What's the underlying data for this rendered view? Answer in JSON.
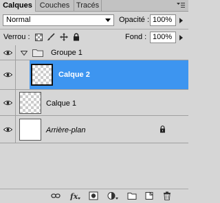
{
  "tabs": [
    {
      "label": "Calques",
      "active": true
    },
    {
      "label": "Couches",
      "active": false
    },
    {
      "label": "Tracés",
      "active": false
    }
  ],
  "blend_mode": "Normal",
  "opacity": {
    "label": "Opacité :",
    "value": "100%"
  },
  "lock": {
    "label": "Verrou :"
  },
  "fill": {
    "label": "Fond :",
    "value": "100%"
  },
  "layers": [
    {
      "name": "Groupe 1",
      "type": "group",
      "selected": false
    },
    {
      "name": "Calque 2",
      "type": "layer",
      "selected": true
    },
    {
      "name": "Calque 1",
      "type": "layer",
      "selected": false
    },
    {
      "name": "Arrière-plan",
      "type": "background",
      "selected": false,
      "locked": true
    }
  ],
  "colors": {
    "selection": "#3d95f0",
    "panel": "#d6d6d6"
  }
}
